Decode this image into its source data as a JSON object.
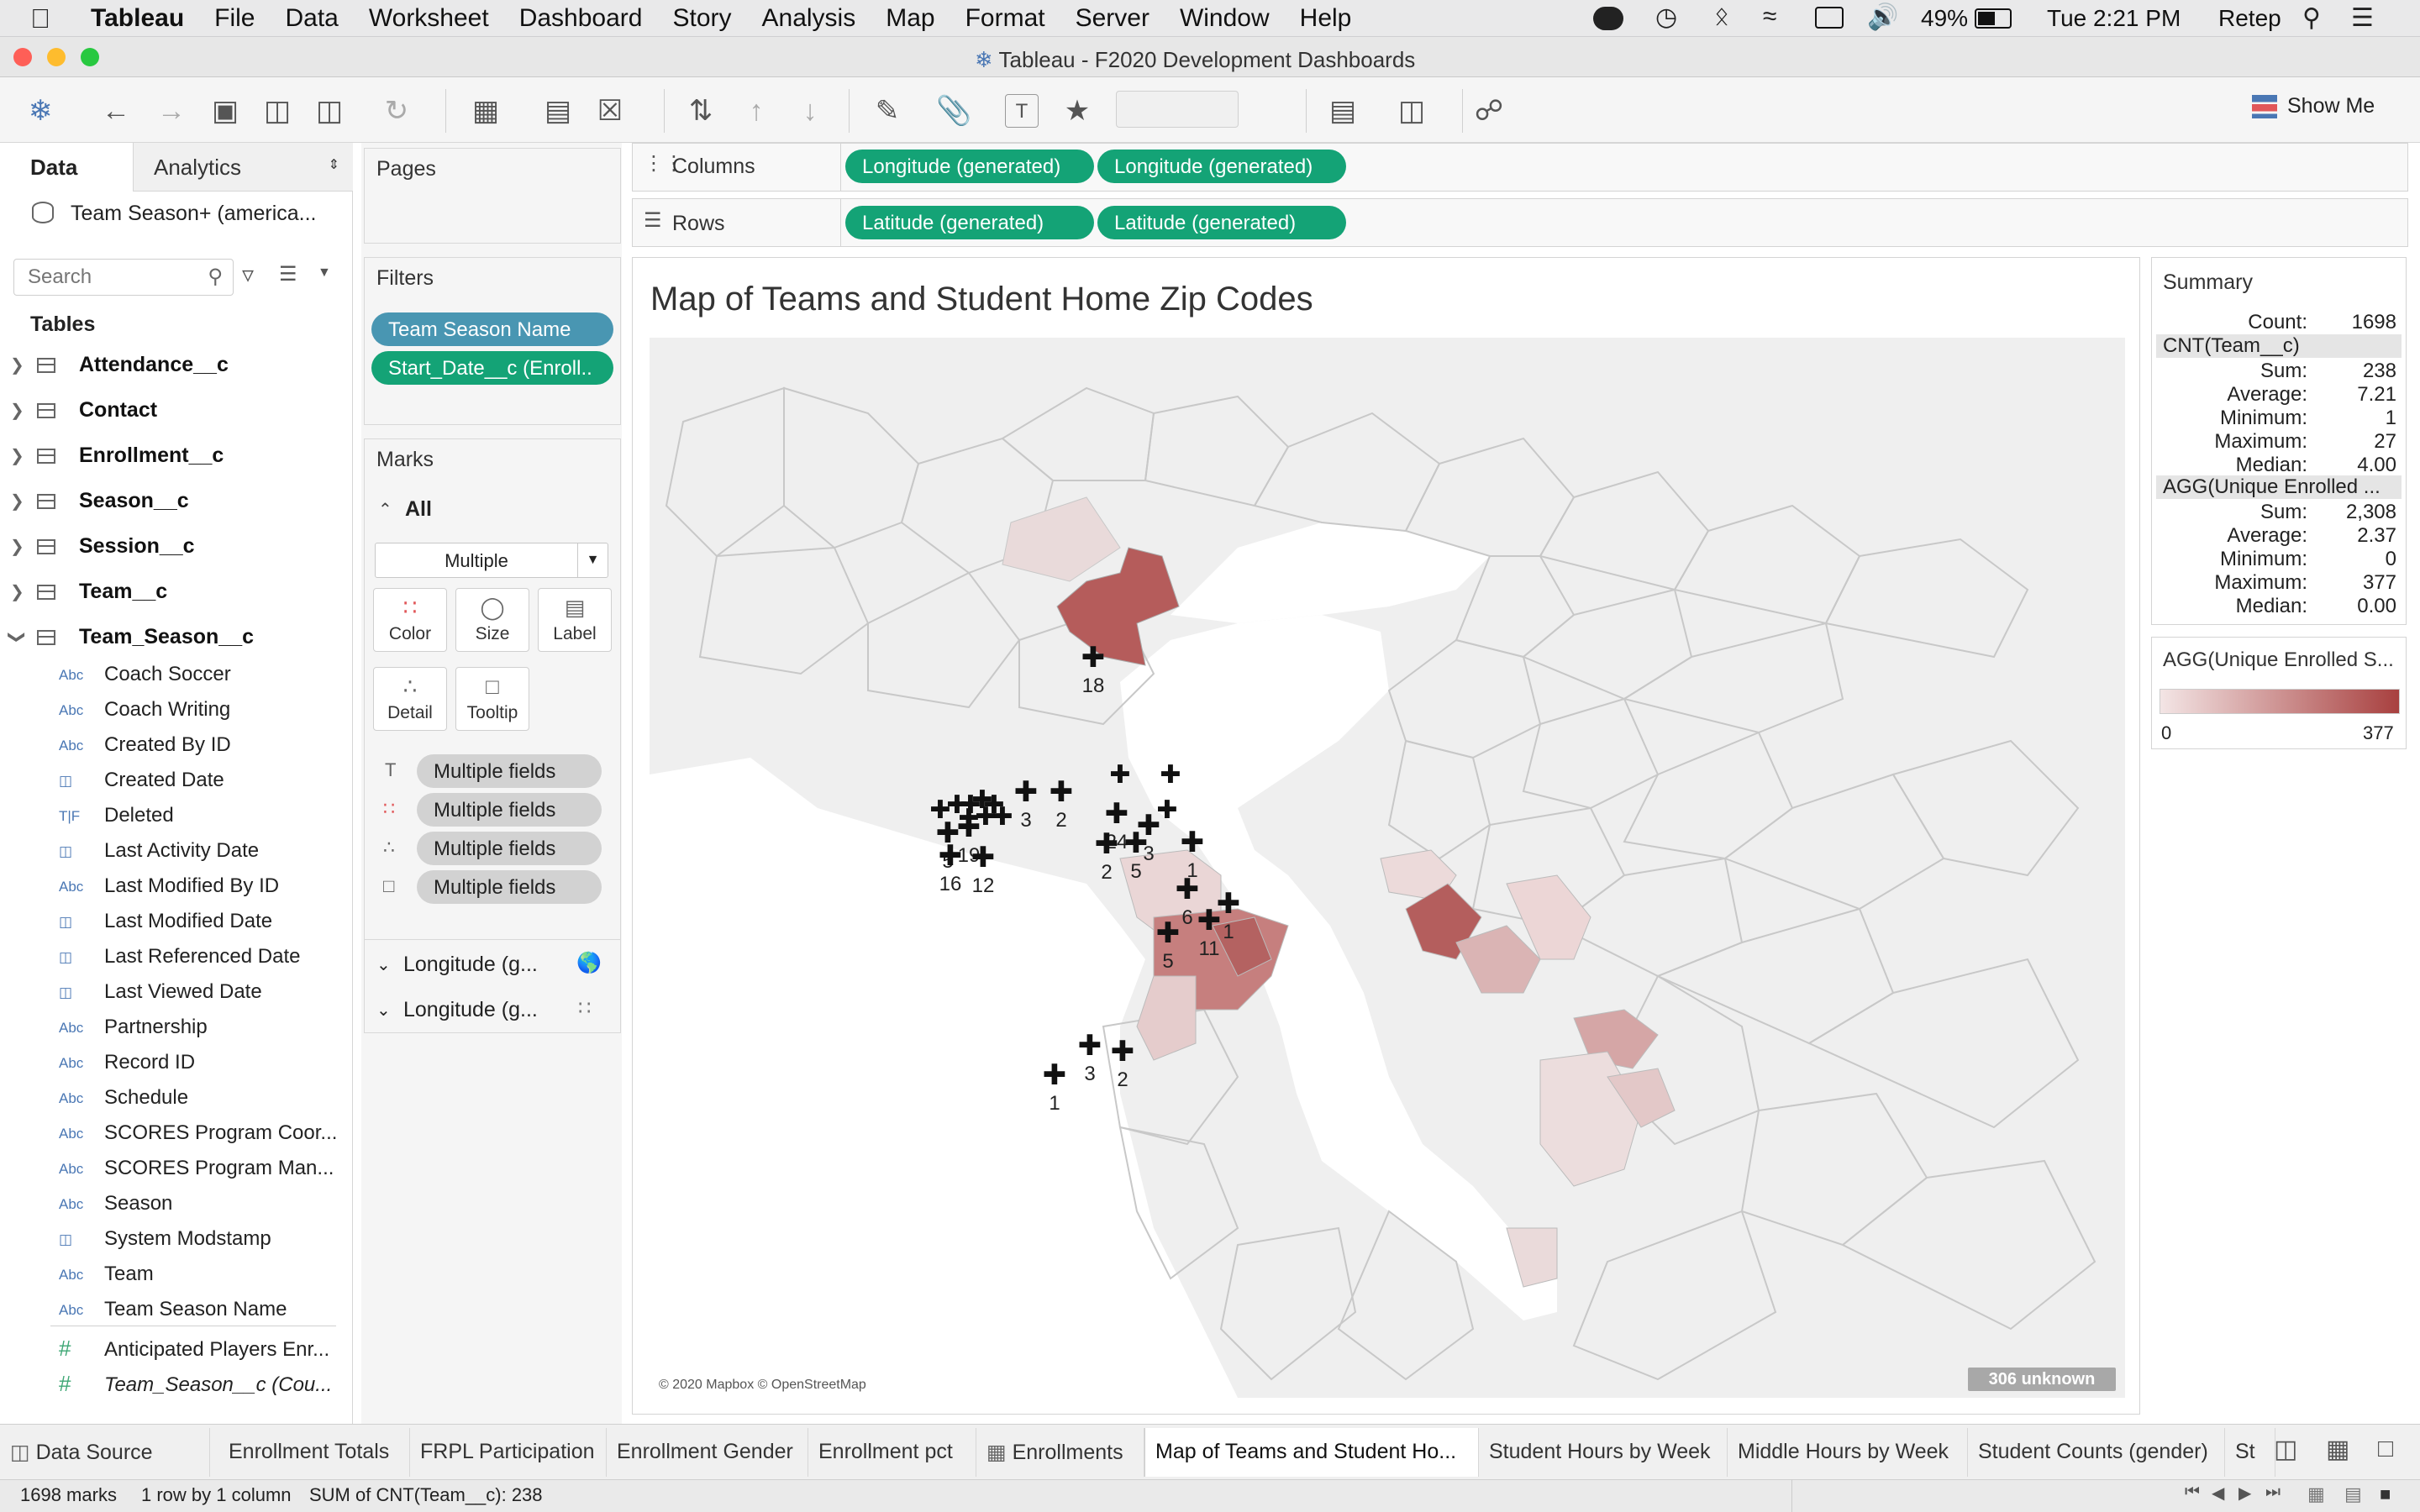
{
  "menubar": {
    "app": "Tableau",
    "items": [
      "File",
      "Data",
      "Worksheet",
      "Dashboard",
      "Story",
      "Analysis",
      "Map",
      "Format",
      "Server",
      "Window",
      "Help"
    ],
    "battery": "49%",
    "clock": "Tue 2:21 PM",
    "user": "Retep"
  },
  "window": {
    "title": "Tableau - F2020 Development Dashboards"
  },
  "toolbar": {
    "show_me": "Show Me"
  },
  "data_pane": {
    "tab_data": "Data",
    "tab_analytics": "Analytics",
    "datasource": "Team Season+ (america...",
    "search_placeholder": "Search",
    "tables_heading": "Tables",
    "tables": [
      "Attendance__c",
      "Contact",
      "Enrollment__c",
      "Season__c",
      "Session__c",
      "Team__c",
      "Team_Season__c"
    ],
    "fields": [
      {
        "type": "Abc",
        "name": "Coach Soccer"
      },
      {
        "type": "Abc",
        "name": "Coach Writing"
      },
      {
        "type": "Abc",
        "name": "Created By ID"
      },
      {
        "type": "date",
        "name": "Created Date"
      },
      {
        "type": "T|F",
        "name": "Deleted"
      },
      {
        "type": "date",
        "name": "Last Activity Date"
      },
      {
        "type": "Abc",
        "name": "Last Modified By ID"
      },
      {
        "type": "date",
        "name": "Last Modified Date"
      },
      {
        "type": "date",
        "name": "Last Referenced Date"
      },
      {
        "type": "date",
        "name": "Last Viewed Date"
      },
      {
        "type": "Abc",
        "name": "Partnership"
      },
      {
        "type": "Abc",
        "name": "Record ID"
      },
      {
        "type": "Abc",
        "name": "Schedule"
      },
      {
        "type": "Abc",
        "name": "SCORES Program Coor..."
      },
      {
        "type": "Abc",
        "name": "SCORES Program Man..."
      },
      {
        "type": "Abc",
        "name": "Season"
      },
      {
        "type": "date",
        "name": "System Modstamp"
      },
      {
        "type": "Abc",
        "name": "Team"
      },
      {
        "type": "Abc",
        "name": "Team Season Name"
      },
      {
        "type": "#",
        "name": "Anticipated Players Enr..."
      },
      {
        "type": "#",
        "name": "Team_Season__c (Cou..."
      }
    ]
  },
  "pages": {
    "title": "Pages"
  },
  "filters": {
    "title": "Filters",
    "items": [
      "Team Season Name",
      "Start_Date__c (Enroll.."
    ]
  },
  "marks": {
    "title": "Marks",
    "all_label": "All",
    "mark_type": "Multiple",
    "buttons": [
      "Color",
      "Size",
      "Label",
      "Detail",
      "Tooltip"
    ],
    "fields": [
      "Multiple fields",
      "Multiple fields",
      "Multiple fields",
      "Multiple fields"
    ],
    "layers": [
      "Longitude (g...",
      "Longitude (g..."
    ]
  },
  "shelves": {
    "columns_label": "Columns",
    "rows_label": "Rows",
    "columns": [
      "Longitude (generated)",
      "Longitude (generated)"
    ],
    "rows": [
      "Latitude (generated)",
      "Latitude (generated)"
    ]
  },
  "viz": {
    "title": "Map of Teams and Student Home Zip Codes",
    "attribution": "© 2020 Mapbox © OpenStreetMap",
    "unknown_badge": "306 unknown",
    "markers": [
      {
        "label": "18"
      },
      {
        "label": "3"
      },
      {
        "label": "2"
      },
      {
        "label": "24"
      },
      {
        "label": "3"
      },
      {
        "label": "2"
      },
      {
        "label": "5"
      },
      {
        "label": "1"
      },
      {
        "label": "5"
      },
      {
        "label": "19"
      },
      {
        "label": "16"
      },
      {
        "label": "12"
      },
      {
        "label": "6"
      },
      {
        "label": "1"
      },
      {
        "label": "11"
      },
      {
        "label": "5"
      },
      {
        "label": "3"
      },
      {
        "label": "2"
      },
      {
        "label": "1"
      }
    ]
  },
  "summary": {
    "title": "Summary",
    "count_label": "Count:",
    "count": "1698",
    "section1": "CNT(Team__c)",
    "s1": [
      [
        "Sum:",
        "238"
      ],
      [
        "Average:",
        "7.21"
      ],
      [
        "Minimum:",
        "1"
      ],
      [
        "Maximum:",
        "27"
      ],
      [
        "Median:",
        "4.00"
      ]
    ],
    "section2": "AGG(Unique Enrolled ...",
    "s2": [
      [
        "Sum:",
        "2,308"
      ],
      [
        "Average:",
        "2.37"
      ],
      [
        "Minimum:",
        "0"
      ],
      [
        "Maximum:",
        "377"
      ],
      [
        "Median:",
        "0.00"
      ]
    ]
  },
  "legend": {
    "title": "AGG(Unique Enrolled S...",
    "min": "0",
    "max": "377",
    "color_low": "#f3e5e5",
    "color_high": "#a8403f"
  },
  "sheet_tabs": {
    "datasource": "Data Source",
    "tabs": [
      "Enrollment Totals",
      "FRPL Participation",
      "Enrollment Gender",
      "Enrollment pct",
      "Enrollments",
      "Map of Teams and Student Ho...",
      "Student Hours by Week",
      "Middle Hours by Week",
      "Student Counts (gender)",
      "St"
    ],
    "active_index": 5
  },
  "status": {
    "marks": "1698 marks",
    "rows_cols": "1 row by 1 column",
    "sum": "SUM of CNT(Team__c): 238"
  }
}
